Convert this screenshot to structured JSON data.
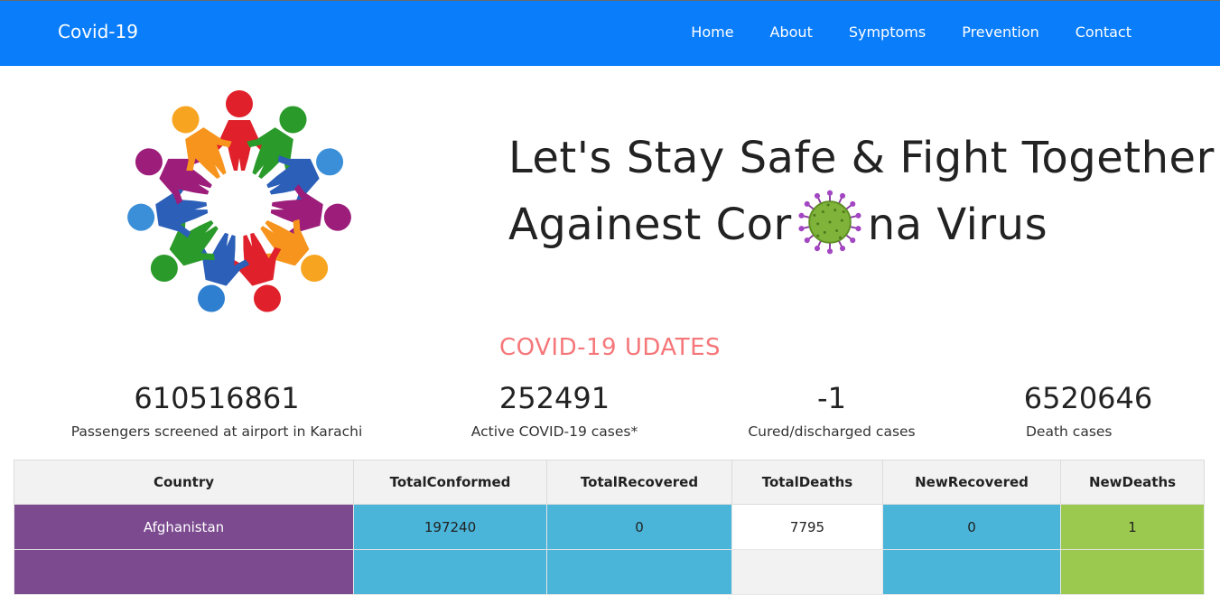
{
  "nav": {
    "brand": "Covid-19",
    "links": [
      "Home",
      "About",
      "Symptoms",
      "Prevention",
      "Contact"
    ]
  },
  "hero": {
    "line1": "Let's Stay Safe & Fight Together",
    "line2_a": "Againest Cor",
    "line2_b": "na Virus"
  },
  "updates": {
    "title": "COVID-19 UDATES",
    "stats": [
      {
        "value": "610516861",
        "label": "Passengers screened at airport in Karachi"
      },
      {
        "value": "252491",
        "label": "Active COVID-19 cases*"
      },
      {
        "value": "-1",
        "label": "Cured/discharged cases"
      },
      {
        "value": "6520646",
        "label": "Death cases"
      }
    ]
  },
  "table": {
    "headers": [
      "Country",
      "TotalConformed",
      "TotalRecovered",
      "TotalDeaths",
      "NewRecovered",
      "NewDeaths"
    ],
    "rows": [
      [
        "Afghanistan",
        "197240",
        "0",
        "7795",
        "0",
        "1"
      ]
    ]
  },
  "colors": {
    "navbar": "#0a7dfb",
    "updates_title": "#f5777a",
    "country_cell": "#7b4a8f",
    "blue_cell": "#4ab5d9",
    "green_cell": "#9bc84e"
  },
  "icons": [
    "people-circle-logo",
    "coronavirus-icon"
  ]
}
